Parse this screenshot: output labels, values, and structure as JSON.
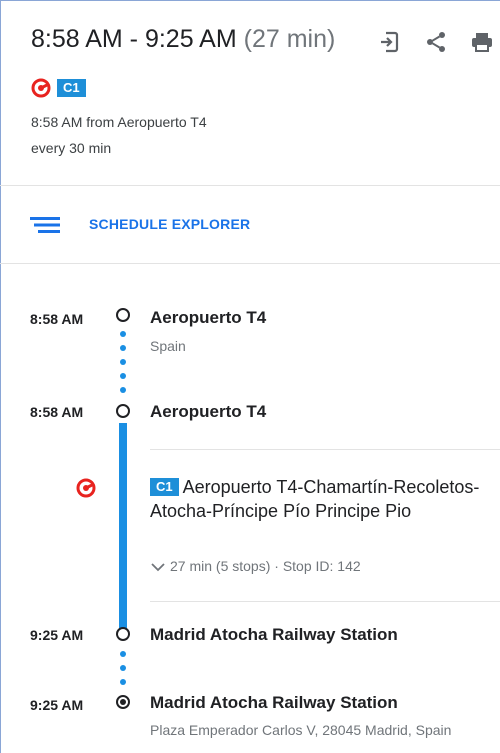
{
  "header": {
    "time_range": "8:58 AM - 9:25 AM",
    "duration": "(27 min)",
    "line_badge": "C1",
    "departure_info": "8:58 AM from Aeropuerto T4",
    "frequency": "every 30 min",
    "icons": [
      "send-to-phone-icon",
      "share-icon",
      "print-icon"
    ]
  },
  "schedule_explorer": {
    "label": "SCHEDULE EXPLORER",
    "icon": "schedule-list-icon"
  },
  "timeline": {
    "stop1": {
      "time": "8:58 AM",
      "name": "Aeropuerto T4",
      "sub": "Spain"
    },
    "stop2": {
      "time": "8:58 AM",
      "name": "Aeropuerto T4"
    },
    "ride": {
      "badge": "C1",
      "route_name": "Aeropuerto T4-Chamartín-Recoletos-Atocha-Príncipe Pío Principe Pio",
      "meta": "27 min (5 stops) · Stop ID: 142"
    },
    "stop3": {
      "time": "9:25 AM",
      "name": "Madrid Atocha Railway Station"
    },
    "stop4": {
      "time": "9:25 AM",
      "name": "Madrid Atocha Railway Station",
      "sub": "Plaza Emperador Carlos V, 28045 Madrid, Spain"
    }
  },
  "colors": {
    "accent": "#1a73e8",
    "line_blue": "#1e8fd8",
    "renfe_red": "#e8231f"
  }
}
